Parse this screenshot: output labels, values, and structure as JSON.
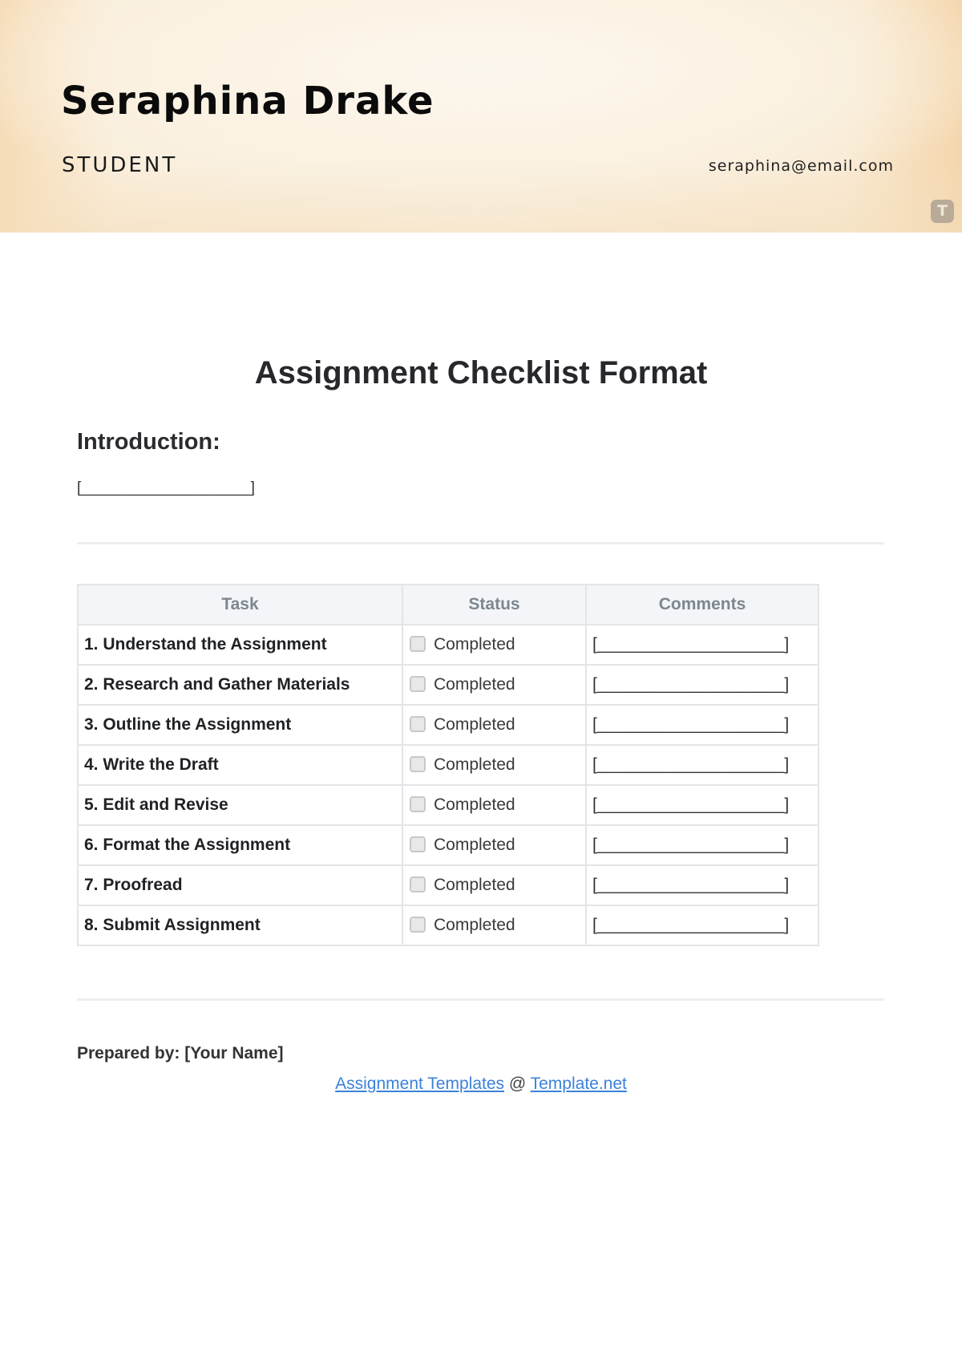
{
  "header": {
    "name": "Seraphina Drake",
    "role": "STUDENT",
    "email": "seraphina@email.com",
    "badge_letter": "T"
  },
  "document": {
    "title": "Assignment Checklist Format",
    "intro_heading": "Introduction:",
    "intro_placeholder": "[____________________]"
  },
  "table": {
    "headers": {
      "task": "Task",
      "status": "Status",
      "comments": "Comments"
    },
    "rows": [
      {
        "task": "1. Understand the Assignment",
        "status": "Completed",
        "checked": false,
        "comment": "[____________________]"
      },
      {
        "task": "2. Research and Gather Materials",
        "status": "Completed",
        "checked": false,
        "comment": "[____________________]"
      },
      {
        "task": "3. Outline the Assignment",
        "status": "Completed",
        "checked": false,
        "comment": "[____________________]"
      },
      {
        "task": "4. Write the Draft",
        "status": "Completed",
        "checked": false,
        "comment": "[____________________]"
      },
      {
        "task": "5. Edit and Revise",
        "status": "Completed",
        "checked": false,
        "comment": "[____________________]"
      },
      {
        "task": "6. Format the Assignment",
        "status": "Completed",
        "checked": false,
        "comment": "[____________________]"
      },
      {
        "task": "7. Proofread",
        "status": "Completed",
        "checked": false,
        "comment": "[____________________]"
      },
      {
        "task": "8. Submit Assignment",
        "status": "Completed",
        "checked": false,
        "comment": "[____________________]"
      }
    ]
  },
  "footer": {
    "prepared_by": "Prepared by: [Your Name]",
    "link_assignment": "Assignment Templates",
    "separator": " @ ",
    "link_site": "Template.net"
  },
  "colors": {
    "link": "#3b82d9",
    "header_accent": "#f6dcb8",
    "table_header_bg": "#f3f5f8",
    "table_header_text": "#7d8790"
  }
}
